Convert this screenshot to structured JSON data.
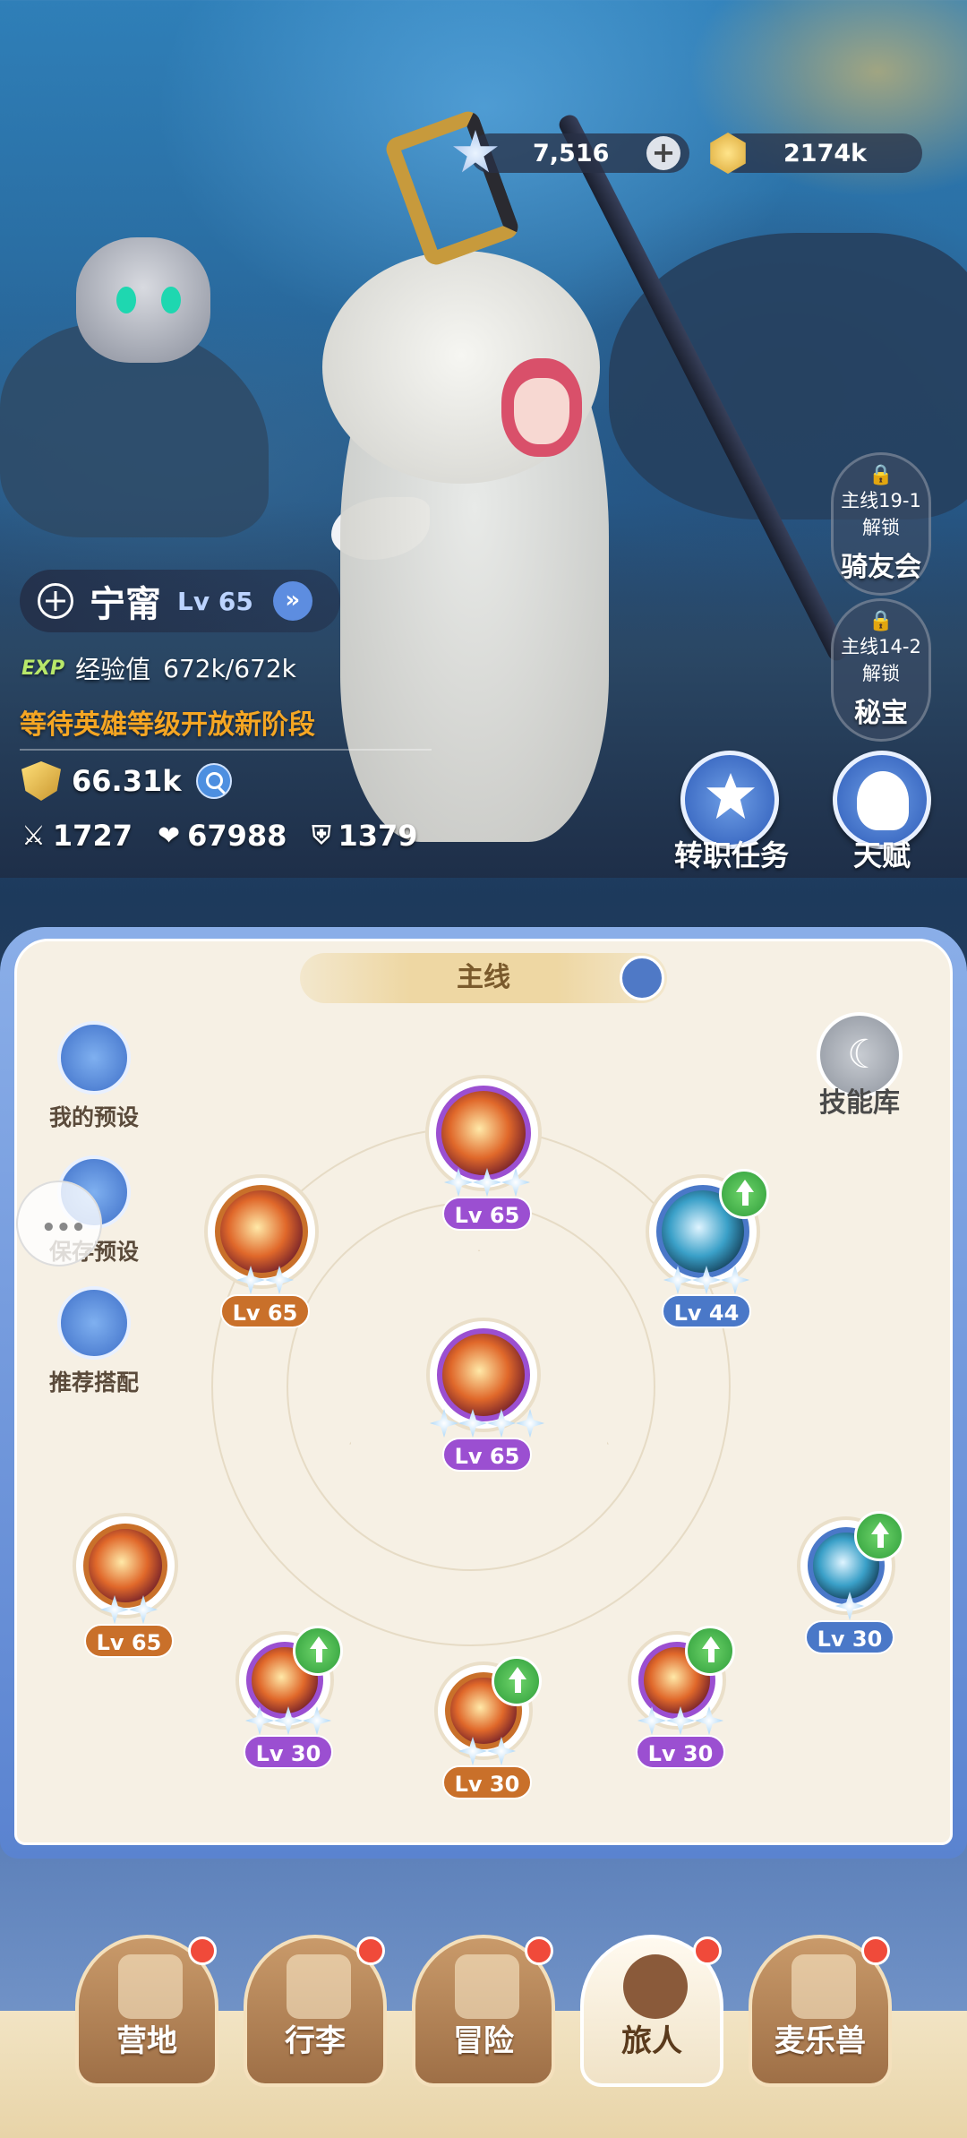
{
  "currency": {
    "stars": "7,516",
    "gold": "2174k"
  },
  "character": {
    "name": "宁甯",
    "level": "Lv 65",
    "exp_tag": "EXP",
    "exp_label": "经验值",
    "exp_value": "672k/672k",
    "stage_notice": "等待英雄等级开放新阶段",
    "power": "66.31k",
    "attack": "1727",
    "hp": "67988",
    "defense": "1379"
  },
  "side_features": [
    {
      "lock": "主线19-1",
      "unlock": "解锁",
      "name": "骑友会"
    },
    {
      "lock": "主线14-2",
      "unlock": "解锁",
      "name": "秘宝"
    }
  ],
  "actions": {
    "job_change": "转职任务",
    "talent": "天赋"
  },
  "skills_panel": {
    "tab_title": "主线",
    "skill_library": "技能库",
    "my_presets": "我的预设",
    "save_preset": "保存预设",
    "recommended": "推荐搭配",
    "skills": [
      {
        "level": "Lv 65",
        "color": "#9b4fd1",
        "stars": 3,
        "upgrade": false
      },
      {
        "level": "Lv 65",
        "color": "#c9702a",
        "stars": 2,
        "upgrade": false
      },
      {
        "level": "Lv 44",
        "color": "#4a78c8",
        "stars": 3,
        "upgrade": true
      },
      {
        "level": "Lv 65",
        "color": "#9b4fd1",
        "stars": 4,
        "upgrade": false
      },
      {
        "level": "Lv 65",
        "color": "#c9702a",
        "stars": 2,
        "upgrade": false
      },
      {
        "level": "Lv 30",
        "color": "#9b4fd1",
        "stars": 3,
        "upgrade": true
      },
      {
        "level": "Lv 30",
        "color": "#c9702a",
        "stars": 2,
        "upgrade": true
      },
      {
        "level": "Lv 30",
        "color": "#9b4fd1",
        "stars": 3,
        "upgrade": true
      },
      {
        "level": "Lv 30",
        "color": "#4a78c8",
        "stars": 1,
        "upgrade": true
      }
    ]
  },
  "nav": [
    {
      "label": "营地",
      "badge": true,
      "active": false
    },
    {
      "label": "行李",
      "badge": true,
      "active": false
    },
    {
      "label": "冒险",
      "badge": true,
      "active": false
    },
    {
      "label": "旅人",
      "badge": true,
      "active": true
    },
    {
      "label": "麦乐兽",
      "badge": true,
      "active": false
    }
  ]
}
